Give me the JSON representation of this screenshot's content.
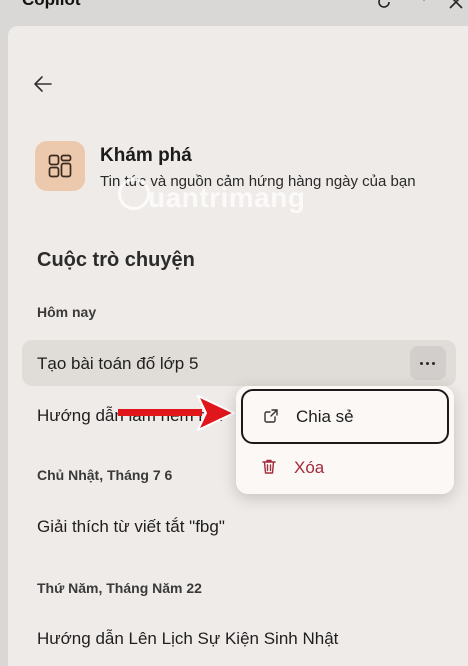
{
  "app": {
    "title": "Copilot"
  },
  "discover": {
    "title": "Khám phá",
    "subtitle": "Tin tức và nguồn cảm hứng hàng ngày của bạn"
  },
  "watermark": "uantrimang",
  "conversations": {
    "title": "Cuộc trò chuyện",
    "groups": [
      {
        "label": "Hôm nay",
        "items": [
          "Tạo bài toán đố lớp 5",
          "Hướng dẫn làm nem rán"
        ]
      },
      {
        "label": "Chủ Nhật, Tháng 7 6",
        "items": [
          "Giải thích từ viết tắt \"fbg\""
        ]
      },
      {
        "label": "Thứ Năm, Tháng Năm 22",
        "items": [
          "Hướng dẫn Lên Lịch Sự Kiện Sinh Nhật"
        ]
      }
    ]
  },
  "context_menu": {
    "share": "Chia sẻ",
    "delete": "Xóa"
  },
  "colors": {
    "panel": "#efebe8",
    "accent_icon_bg": "#ecc9ad",
    "delete_red": "#a32b3b",
    "arrow_red": "#e0161b"
  }
}
